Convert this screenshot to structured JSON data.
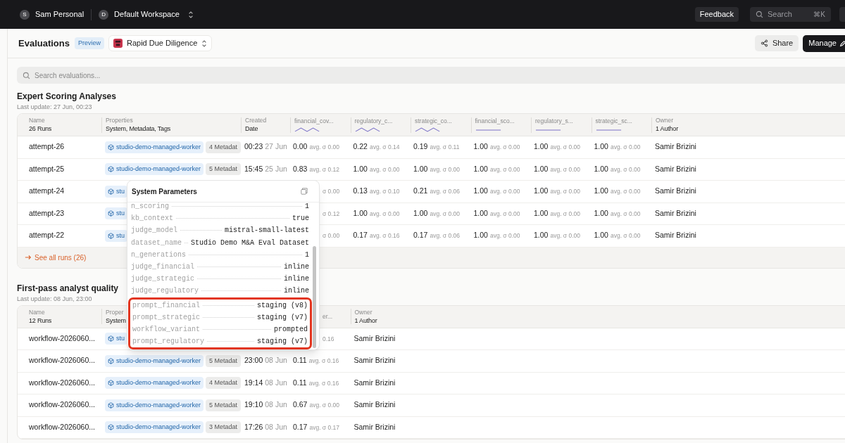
{
  "topbar": {
    "account": {
      "initial": "S",
      "name": "Sam Personal"
    },
    "workspace": {
      "initial": "D",
      "name": "Default Workspace"
    },
    "feedback": "Feedback",
    "search": {
      "placeholder": "Search",
      "shortcut": "⌘K"
    }
  },
  "header": {
    "title": "Evaluations",
    "badge": "Preview",
    "project": "Rapid Due Diligence",
    "share": "Share",
    "manage": "Manage"
  },
  "search": {
    "placeholder": "Search evaluations..."
  },
  "sections": [
    {
      "title": "Expert Scoring Analyses",
      "updated": "Last update: 27 Jun, 00:23",
      "columns": [
        {
          "kind": "name",
          "label": "Name",
          "sub": "26 Runs"
        },
        {
          "kind": "properties",
          "label": "Properties",
          "sub": "System, Metadata, Tags"
        },
        {
          "kind": "created",
          "label": "Created",
          "sub": "Date"
        },
        {
          "kind": "metric",
          "label": "financial_cov...",
          "sparkline": {
            "kind": "wave"
          }
        },
        {
          "kind": "metric",
          "label": "regulatory_c...",
          "sparkline": {
            "kind": "wave"
          }
        },
        {
          "kind": "metric",
          "label": "strategic_co...",
          "sparkline": {
            "kind": "wave"
          }
        },
        {
          "kind": "metric",
          "label": "financial_sco...",
          "sparkline": {
            "kind": "flat"
          }
        },
        {
          "kind": "metric",
          "label": "regulatory_s...",
          "sparkline": {
            "kind": "flat"
          }
        },
        {
          "kind": "metric",
          "label": "strategic_sc...",
          "sparkline": {
            "kind": "flat"
          }
        },
        {
          "kind": "owner",
          "label": "Owner",
          "sub": "1 Author"
        }
      ],
      "rows": [
        {
          "name": "attempt-26",
          "tag": "studio-demo-managed-worker",
          "metadata": "4 Metadat",
          "created": {
            "time": "00:23",
            "date": "27 Jun"
          },
          "metrics": [
            {
              "value": "0.00",
              "stat": "avg. σ 0.00"
            },
            {
              "value": "0.22",
              "stat": "avg. σ 0.14"
            },
            {
              "value": "0.19",
              "stat": "avg. σ 0.11"
            },
            {
              "value": "1.00",
              "stat": "avg. σ 0.00"
            },
            {
              "value": "1.00",
              "stat": "avg. σ 0.00"
            },
            {
              "value": "1.00",
              "stat": "avg. σ 0.00"
            }
          ],
          "owner": "Samir Brizini"
        },
        {
          "name": "attempt-25",
          "tag": "studio-demo-managed-worker",
          "metadata": "5 Metadat",
          "created": {
            "time": "15:45",
            "date": "25 Jun"
          },
          "metrics": [
            {
              "value": "0.83",
              "stat": "avg. σ 0.12"
            },
            {
              "value": "1.00",
              "stat": "avg. σ 0.00"
            },
            {
              "value": "1.00",
              "stat": "avg. σ 0.00"
            },
            {
              "value": "1.00",
              "stat": "avg. σ 0.00"
            },
            {
              "value": "1.00",
              "stat": "avg. σ 0.00"
            },
            {
              "value": "1.00",
              "stat": "avg. σ 0.00"
            }
          ],
          "owner": "Samir Brizini"
        },
        {
          "name": "attempt-24",
          "tag": "stu",
          "metrics": [
            {
              "stat": "σ 0.00"
            },
            {
              "value": "0.13",
              "stat": "avg. σ 0.10"
            },
            {
              "value": "0.21",
              "stat": "avg. σ 0.06"
            },
            {
              "value": "1.00",
              "stat": "avg. σ 0.00"
            },
            {
              "value": "1.00",
              "stat": "avg. σ 0.00"
            },
            {
              "value": "1.00",
              "stat": "avg. σ 0.00"
            }
          ],
          "owner": "Samir Brizini"
        },
        {
          "name": "attempt-23",
          "tag": "stu",
          "metrics": [
            {
              "stat": "σ 0.12"
            },
            {
              "value": "1.00",
              "stat": "avg. σ 0.00"
            },
            {
              "value": "1.00",
              "stat": "avg. σ 0.00"
            },
            {
              "value": "1.00",
              "stat": "avg. σ 0.00"
            },
            {
              "value": "1.00",
              "stat": "avg. σ 0.00"
            },
            {
              "value": "1.00",
              "stat": "avg. σ 0.00"
            }
          ],
          "owner": "Samir Brizini"
        },
        {
          "name": "attempt-22",
          "tag": "stu",
          "metrics": [
            {
              "stat": "σ 0.00"
            },
            {
              "value": "0.17",
              "stat": "avg. σ 0.16"
            },
            {
              "value": "0.17",
              "stat": "avg. σ 0.06"
            },
            {
              "value": "1.00",
              "stat": "avg. σ 0.00"
            },
            {
              "value": "1.00",
              "stat": "avg. σ 0.00"
            },
            {
              "value": "1.00",
              "stat": "avg. σ 0.00"
            }
          ],
          "owner": "Samir Brizini"
        }
      ],
      "see_all": "See all runs (26)"
    },
    {
      "title": "First-pass analyst quality",
      "updated": "Last update: 08 Jun, 23:00",
      "columns": [
        {
          "kind": "name",
          "label": "Name",
          "sub": "12 Runs"
        },
        {
          "kind": "properties",
          "label": "Proper",
          "sub": "System"
        },
        {
          "kind": "created"
        },
        {
          "kind": "metric",
          "label": "er..."
        },
        {
          "kind": "owner",
          "label": "Owner",
          "sub": "1 Author"
        }
      ],
      "rows": [
        {
          "name": "workflow-2026060...",
          "tag": "stu",
          "metrics": [
            {
              "stat": "0.16"
            }
          ],
          "owner": "Samir Brizini"
        },
        {
          "name": "workflow-2026060...",
          "tag": "studio-demo-managed-worker",
          "metadata": "5 Metadat",
          "created": {
            "time": "23:00",
            "date": "08 Jun"
          },
          "metrics": [
            {
              "value": "0.11",
              "stat": "avg. σ 0.16"
            }
          ],
          "owner": "Samir Brizini"
        },
        {
          "name": "workflow-2026060...",
          "tag": "studio-demo-managed-worker",
          "metadata": "4 Metadat",
          "created": {
            "time": "19:14",
            "date": "08 Jun"
          },
          "metrics": [
            {
              "value": "0.11",
              "stat": "avg. σ 0.16"
            }
          ],
          "owner": "Samir Brizini"
        },
        {
          "name": "workflow-2026060...",
          "tag": "studio-demo-managed-worker",
          "metadata": "5 Metadat",
          "created": {
            "time": "19:10",
            "date": "08 Jun"
          },
          "metrics": [
            {
              "value": "0.67",
              "stat": "avg. σ 0.00"
            }
          ],
          "owner": "Samir Brizini"
        },
        {
          "name": "workflow-2026060...",
          "tag": "studio-demo-managed-worker",
          "metadata": "3 Metadat",
          "created": {
            "time": "17:26",
            "date": "08 Jun"
          },
          "metrics": [
            {
              "value": "0.17",
              "stat": "avg. σ 0.17"
            }
          ],
          "owner": "Samir Brizini"
        }
      ]
    }
  ],
  "popup": {
    "title": "System Parameters",
    "params": [
      {
        "key": "n_scoring",
        "value": "1",
        "highlighted": false
      },
      {
        "key": "kb_context",
        "value": "true",
        "highlighted": false
      },
      {
        "key": "judge_model",
        "value": "mistral-small-latest",
        "highlighted": false
      },
      {
        "key": "dataset_name",
        "value": "Studio Demo M&A Eval Dataset",
        "highlighted": false
      },
      {
        "key": "n_generations",
        "value": "1",
        "highlighted": false
      },
      {
        "key": "judge_financial",
        "value": "inline",
        "highlighted": false
      },
      {
        "key": "judge_strategic",
        "value": "inline",
        "highlighted": false
      },
      {
        "key": "judge_regulatory",
        "value": "inline",
        "highlighted": false
      },
      {
        "key": "prompt_financial",
        "value": "staging (v8)",
        "highlighted": true
      },
      {
        "key": "prompt_strategic",
        "value": "staging (v7)",
        "highlighted": true
      },
      {
        "key": "workflow_variant",
        "value": "prompted",
        "highlighted": true
      },
      {
        "key": "prompt_regulatory",
        "value": "staging (v7)",
        "highlighted": true
      }
    ]
  }
}
